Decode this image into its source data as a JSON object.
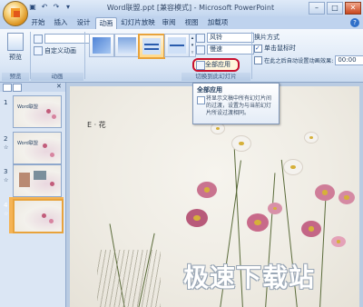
{
  "window": {
    "title": "Word联盟.ppt [兼容模式] - Microsoft PowerPoint"
  },
  "tabs": [
    {
      "label": "开始"
    },
    {
      "label": "插入"
    },
    {
      "label": "设计"
    },
    {
      "label": "动画",
      "active": true
    },
    {
      "label": "幻灯片放映"
    },
    {
      "label": "审阅"
    },
    {
      "label": "视图"
    },
    {
      "label": "加载项"
    }
  ],
  "ribbon": {
    "preview_label": "预览",
    "preview_group": "预览",
    "custom_anim_label": "自定义动画",
    "anim_group": "动画",
    "sound_label": "风铃",
    "speed_label": "慢速",
    "apply_all_label": "全部应用",
    "transition_group": "切换到此幻灯片",
    "advance_label": "换片方式",
    "on_click_label": "单击鼠标时",
    "after_label": "在此之后自动设置动画效果:",
    "after_time": "00:00"
  },
  "tooltip": {
    "title": "全部应用",
    "body": "将显示文稿中所有幻灯片间的过渡，设置为与当前幻灯片所设过渡相同。"
  },
  "slides": [
    {
      "number": "1",
      "title": "Word联盟"
    },
    {
      "number": "2",
      "title": "Word联盟"
    },
    {
      "number": "3",
      "title": ""
    },
    {
      "number": "4",
      "title": "",
      "selected": true
    }
  ],
  "slide": {
    "title": "E · 花"
  },
  "watermark": "极速下载站",
  "colors": {
    "accent": "#e8a33c",
    "highlight_ring": "#c8102e",
    "ribbon_bg": "#dbe7f6"
  }
}
